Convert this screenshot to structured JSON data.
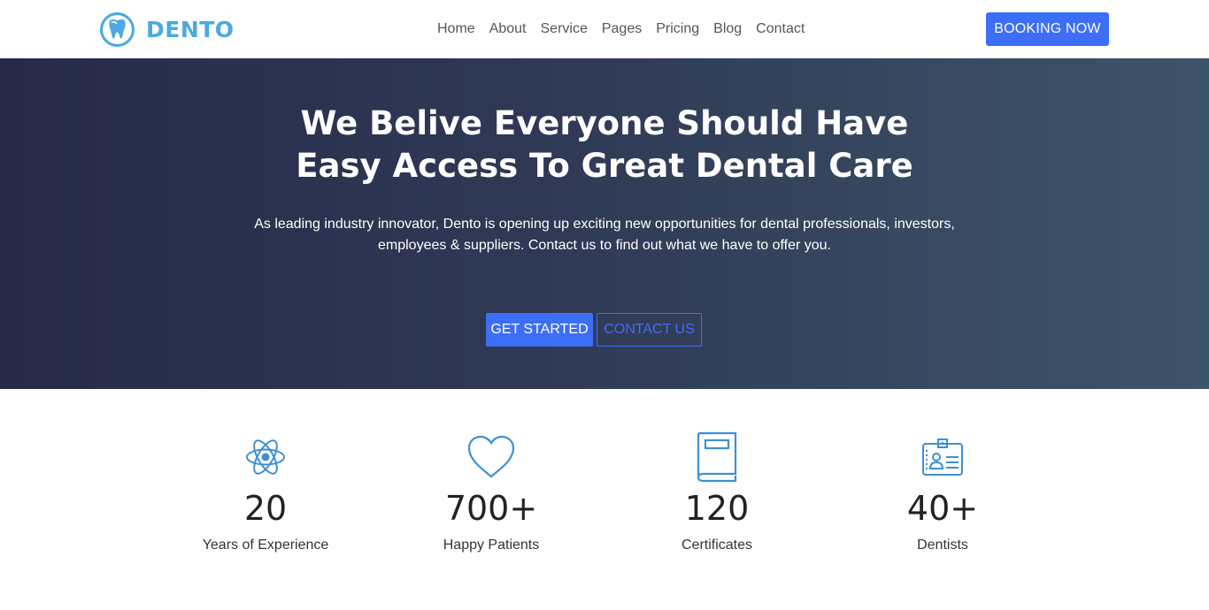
{
  "brand": {
    "name": "DENTO",
    "logo_icon": "tooth-logo-icon",
    "color": "#4aa9e0"
  },
  "nav": {
    "items": [
      {
        "label": "Home"
      },
      {
        "label": "About"
      },
      {
        "label": "Service"
      },
      {
        "label": "Pages"
      },
      {
        "label": "Pricing"
      },
      {
        "label": "Blog"
      },
      {
        "label": "Contact"
      }
    ],
    "booking_label": "BOOKING NOW"
  },
  "hero": {
    "title_line1": "We Belive Everyone Should Have",
    "title_line2": "Easy Access To Great Dental Care",
    "subtitle_line1": "As leading industry innovator, Dento is opening up exciting new opportunities for dental professionals, investors,",
    "subtitle_line2": "employees & suppliers. Contact us to find out what we have to offer you.",
    "primary_button": "GET STARTED",
    "secondary_button": "CONTACT US"
  },
  "stats": [
    {
      "icon": "atom-icon",
      "value": "20",
      "label": "Years of Experience"
    },
    {
      "icon": "heart-icon",
      "value": "700+",
      "label": "Happy Patients"
    },
    {
      "icon": "book-icon",
      "value": "120",
      "label": "Certificates"
    },
    {
      "icon": "id-card-icon",
      "value": "40+",
      "label": "Dentists"
    }
  ],
  "colors": {
    "accent": "#3d6ef7",
    "icon_blue": "#3f8fd2",
    "hero_start": "#262a48",
    "hero_end": "#3e5468"
  }
}
